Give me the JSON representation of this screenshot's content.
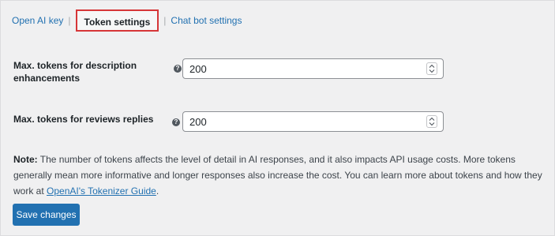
{
  "tabs": {
    "openai_key": "Open AI key",
    "token_settings": "Token settings",
    "chat_bot_settings": "Chat bot settings",
    "separator": "|"
  },
  "fields": [
    {
      "label": "Max. tokens for description enhancements",
      "help": "?",
      "value": "200"
    },
    {
      "label": "Max. tokens for reviews replies",
      "help": "?",
      "value": "200"
    }
  ],
  "note": {
    "prefix": "Note:",
    "body": " The number of tokens affects the level of detail in AI responses, and it also impacts API usage costs. More tokens generally mean more informative and longer responses also increase the cost. You can learn more about tokens and how they work at ",
    "link": "OpenAI's Tokenizer Guide",
    "suffix": "."
  },
  "save_label": "Save changes",
  "colors": {
    "accent": "#2271b1",
    "highlight_border": "#d63638",
    "background": "#f0f0f1"
  }
}
